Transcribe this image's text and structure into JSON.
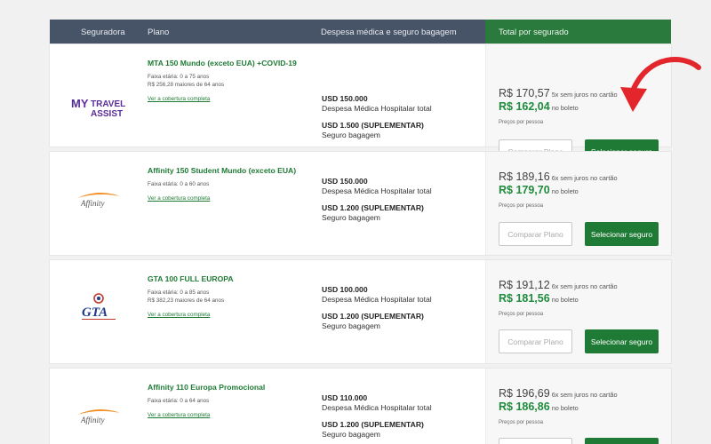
{
  "header": {
    "col_insurer": "Seguradora",
    "col_plan": "Plano",
    "col_expenses": "Despesa médica e seguro bagagem",
    "col_total": "Total por segurado"
  },
  "common": {
    "medical_label": "Despesa Médica Hospitalar total",
    "baggage_label": "Seguro bagagem",
    "coverage_link": "Ver a cobertura completa",
    "card_suffix": "6x sem juros no cartão",
    "card_suffix_first": "5x sem juros no cartão",
    "boleto_suffix": "no boleto",
    "per_person": "Preços por pessoa",
    "compare_label": "Comparar Plano",
    "select_label": "Selecionar seguro"
  },
  "plans": [
    {
      "insurer_logo_text": "MY TRAVEL ASSIST",
      "name": "MTA 150 Mundo (exceto EUA) +COVID-19",
      "age_range": "Faixa etária: 0 a 75 anos",
      "senior_price": "R$ 256,28 maiores de 64 anos",
      "medical_amount": "USD 150.000",
      "medical_label": "Despesa Médica Hospitalar total",
      "baggage_amount": "USD 1.500 (SUPLEMENTAR)",
      "card_price": "R$ 170,57",
      "card_suffix": "5x sem juros no cartão",
      "boleto_price": "R$ 162,04"
    },
    {
      "insurer_logo_text": "Affinity",
      "name": "Affinity 150 Student Mundo (exceto EUA)",
      "age_range": "Faixa etária: 0 a 60 anos",
      "senior_price": "",
      "medical_amount": "USD 150.000",
      "medical_label": "Despesa Médica Hospitalar total",
      "baggage_amount": "USD 1.200 (SUPLEMENTAR)",
      "card_price": "R$ 189,16",
      "card_suffix": "6x sem juros no cartão",
      "boleto_price": "R$ 179,70"
    },
    {
      "insurer_logo_text": "GTA",
      "name": "GTA 100 FULL EUROPA",
      "age_range": "Faixa etária: 0 a 85 anos",
      "senior_price": "R$ 382,23 maiores de 64 anos",
      "medical_amount": "USD 100.000",
      "medical_label": "Despesa Médica Hospitalar total",
      "baggage_amount": "USD 1.200 (SUPLEMENTAR)",
      "card_price": "R$ 191,12",
      "card_suffix": "6x sem juros no cartão",
      "boleto_price": "R$ 181,56"
    },
    {
      "insurer_logo_text": "Affinity",
      "name": "Affinity 110 Europa Promocional",
      "age_range": "Faixa etária: 0 a 64 anos",
      "senior_price": "",
      "medical_amount": "USD 110.000",
      "medical_label": "Despesa Médica Hospitalar total",
      "baggage_amount": "USD 1.200 (SUPLEMENTAR)",
      "card_price": "R$ 196,69",
      "card_suffix": "6x sem juros no cartão",
      "boleto_price": "R$ 186,86"
    }
  ],
  "colors": {
    "header_dark": "#475467",
    "header_green": "#2b7a3d",
    "accent_green": "#1f7a35",
    "arrow_red": "#e3262b"
  },
  "icons": {
    "annotation": "curved-arrow-icon"
  }
}
